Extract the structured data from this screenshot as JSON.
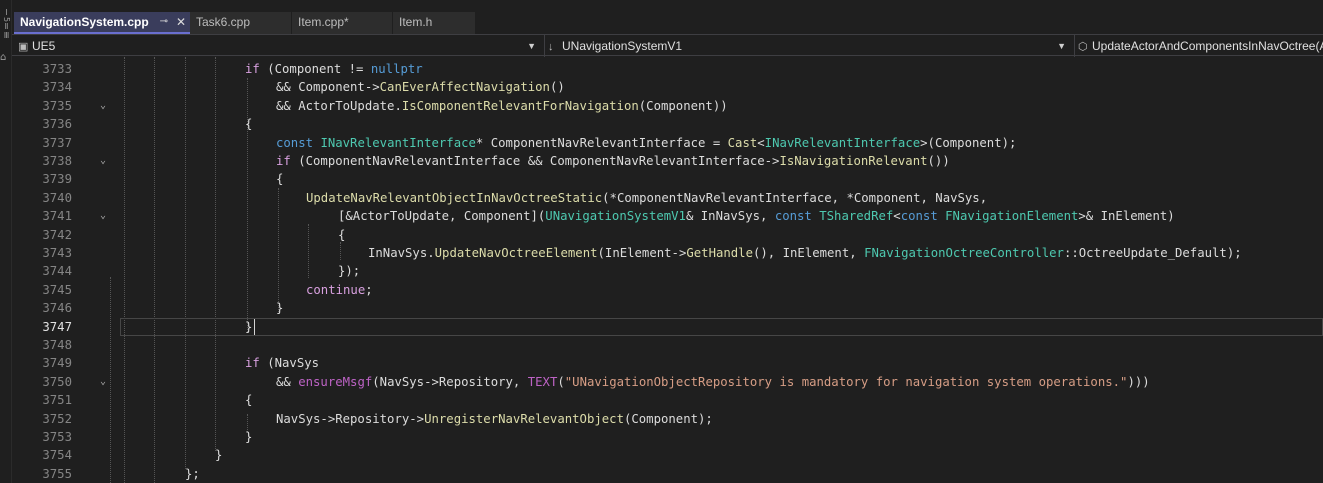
{
  "side_strip": {
    "text": "Ⅰ5ⅡⅢ",
    "icon": "bookmark-icon"
  },
  "tabs": [
    {
      "label": "NavigationSystem.cpp",
      "active": true,
      "pin": "⊸",
      "close": "✕"
    },
    {
      "label": "Task6.cpp",
      "active": false
    },
    {
      "label": "Item.cpp*",
      "active": false
    },
    {
      "label": "Item.h",
      "active": false
    }
  ],
  "navbar": {
    "project": "UE5",
    "scope": "UNavigationSystemV1",
    "member": "UpdateActorAndComponentsInNavOctree(AActor& ActorToUpdate, bool bUpdateAttachedActors)",
    "project_icon": "project-icon",
    "scope_icon": "scope-arrow-icon",
    "member_icon": "method-cube-icon"
  },
  "editor": {
    "current_line": "3747",
    "lines": [
      {
        "num": "3733",
        "fold": false,
        "tokens": [
          [
            "ctl",
            "if"
          ],
          [
            "p",
            " (Component "
          ],
          [
            "p",
            "!="
          ],
          [
            "p",
            " "
          ],
          [
            "kw",
            "nullptr"
          ]
        ]
      },
      {
        "num": "3734",
        "fold": false,
        "tokens": [
          [
            "p",
            "&& Component->"
          ],
          [
            "fn",
            "CanEverAffectNavigation"
          ],
          [
            "p",
            "()"
          ]
        ]
      },
      {
        "num": "3735",
        "fold": true,
        "tokens": [
          [
            "p",
            "&& ActorToUpdate."
          ],
          [
            "fn",
            "IsComponentRelevantForNavigation"
          ],
          [
            "p",
            "(Component))"
          ]
        ]
      },
      {
        "num": "3736",
        "fold": false,
        "tokens": [
          [
            "p",
            "{"
          ]
        ]
      },
      {
        "num": "3737",
        "fold": false,
        "tokens": [
          [
            "kw",
            "const"
          ],
          [
            "p",
            " "
          ],
          [
            "ty",
            "INavRelevantInterface"
          ],
          [
            "p",
            "* ComponentNavRelevantInterface = "
          ],
          [
            "fn",
            "Cast"
          ],
          [
            "p",
            "<"
          ],
          [
            "ty",
            "INavRelevantInterface"
          ],
          [
            "p",
            ">(Component);"
          ]
        ]
      },
      {
        "num": "3738",
        "fold": true,
        "tokens": [
          [
            "ctl",
            "if"
          ],
          [
            "p",
            " (ComponentNavRelevantInterface && ComponentNavRelevantInterface->"
          ],
          [
            "fn",
            "IsNavigationRelevant"
          ],
          [
            "p",
            "())"
          ]
        ]
      },
      {
        "num": "3739",
        "fold": false,
        "tokens": [
          [
            "p",
            "{"
          ]
        ]
      },
      {
        "num": "3740",
        "fold": false,
        "tokens": [
          [
            "fn",
            "UpdateNavRelevantObjectInNavOctreeStatic"
          ],
          [
            "p",
            "(*ComponentNavRelevantInterface, *Component, NavSys,"
          ]
        ]
      },
      {
        "num": "3741",
        "fold": true,
        "tokens": [
          [
            "p",
            "[&ActorToUpdate, Component]("
          ],
          [
            "ty",
            "UNavigationSystemV1"
          ],
          [
            "p",
            "& InNavSys, "
          ],
          [
            "kw",
            "const"
          ],
          [
            "p",
            " "
          ],
          [
            "ty",
            "TSharedRef"
          ],
          [
            "p",
            "<"
          ],
          [
            "kw",
            "const"
          ],
          [
            "p",
            " "
          ],
          [
            "ty",
            "FNavigationElement"
          ],
          [
            "p",
            ">& InElement)"
          ]
        ]
      },
      {
        "num": "3742",
        "fold": false,
        "tokens": [
          [
            "p",
            "{"
          ]
        ]
      },
      {
        "num": "3743",
        "fold": false,
        "tokens": [
          [
            "p",
            "InNavSys."
          ],
          [
            "fn",
            "UpdateNavOctreeElement"
          ],
          [
            "p",
            "(InElement->"
          ],
          [
            "fn",
            "GetHandle"
          ],
          [
            "p",
            "(), InElement, "
          ],
          [
            "ty",
            "FNavigationOctreeController"
          ],
          [
            "p",
            "::OctreeUpdate_Default);"
          ]
        ]
      },
      {
        "num": "3744",
        "fold": false,
        "tokens": [
          [
            "p",
            "});"
          ]
        ]
      },
      {
        "num": "3745",
        "fold": false,
        "tokens": [
          [
            "ctl",
            "continue"
          ],
          [
            "p",
            ";"
          ]
        ]
      },
      {
        "num": "3746",
        "fold": false,
        "tokens": [
          [
            "p",
            "}"
          ]
        ]
      },
      {
        "num": "3747",
        "fold": false,
        "tokens": [
          [
            "p",
            "}"
          ]
        ]
      },
      {
        "num": "3748",
        "fold": false,
        "tokens": []
      },
      {
        "num": "3749",
        "fold": false,
        "tokens": [
          [
            "ctl",
            "if"
          ],
          [
            "p",
            " (NavSys"
          ]
        ]
      },
      {
        "num": "3750",
        "fold": true,
        "tokens": [
          [
            "p",
            "&& "
          ],
          [
            "mac",
            "ensureMsgf"
          ],
          [
            "p",
            "(NavSys->Repository, "
          ],
          [
            "mac",
            "TEXT"
          ],
          [
            "p",
            "("
          ],
          [
            "str",
            "\"UNavigationObjectRepository is mandatory for navigation system operations.\""
          ],
          [
            "p",
            ")))"
          ]
        ]
      },
      {
        "num": "3751",
        "fold": false,
        "tokens": [
          [
            "p",
            "{"
          ]
        ]
      },
      {
        "num": "3752",
        "fold": false,
        "tokens": [
          [
            "p",
            "NavSys->Repository->"
          ],
          [
            "fn",
            "UnregisterNavRelevantObject"
          ],
          [
            "p",
            "(Component);"
          ]
        ]
      },
      {
        "num": "3753",
        "fold": false,
        "tokens": [
          [
            "p",
            "}"
          ]
        ]
      },
      {
        "num": "3754",
        "fold": false,
        "tokens": [
          [
            "p",
            "}"
          ]
        ]
      },
      {
        "num": "3755",
        "fold": false,
        "tokens": [
          [
            "p",
            "};"
          ]
        ]
      }
    ]
  },
  "colors": {
    "keyword": "#569cd6",
    "control": "#d8a0df",
    "type": "#4ec9b0",
    "function": "#dcdcaa",
    "string": "#d69d85",
    "macro": "#bd63c5",
    "active_tab": "#3a3d5c"
  }
}
